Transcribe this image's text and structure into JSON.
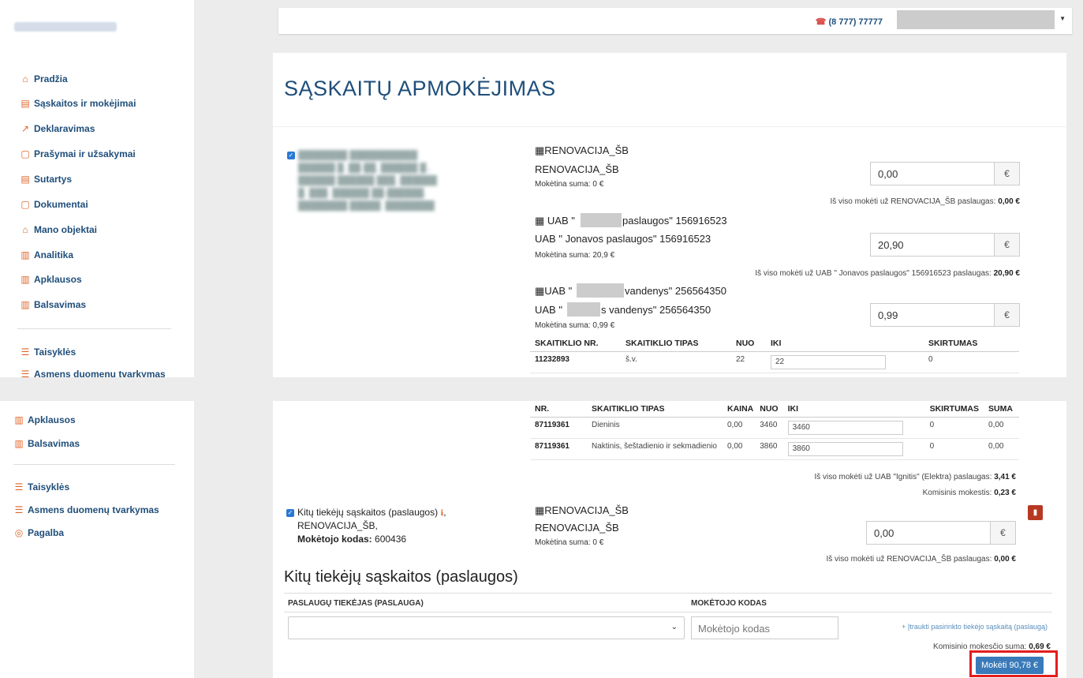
{
  "header": {
    "phone": "(8 777) 77777"
  },
  "sidebar": {
    "items": [
      {
        "icon": "home-icon",
        "glyph": "⌂",
        "label": "Pradžia"
      },
      {
        "icon": "invoice-icon",
        "glyph": "▤",
        "label": "Sąskaitos ir mokėjimai"
      },
      {
        "icon": "declaration-icon",
        "glyph": "↗",
        "label": "Deklaravimas"
      },
      {
        "icon": "request-icon",
        "glyph": "▢",
        "label": "Prašymai ir užsakymai"
      },
      {
        "icon": "contract-icon",
        "glyph": "▤",
        "label": "Sutartys"
      },
      {
        "icon": "document-icon",
        "glyph": "▢",
        "label": "Dokumentai"
      },
      {
        "icon": "property-icon",
        "glyph": "⌂",
        "label": "Mano objektai"
      },
      {
        "icon": "analytics-icon",
        "glyph": "▥",
        "label": "Analitika"
      },
      {
        "icon": "survey-icon",
        "glyph": "▥",
        "label": "Apklausos"
      },
      {
        "icon": "vote-icon",
        "glyph": "▥",
        "label": "Balsavimas"
      },
      {
        "icon": "rules-icon",
        "glyph": "☰",
        "label": "Taisyklės"
      },
      {
        "icon": "privacy-icon",
        "glyph": "☰",
        "label": "Asmens duomenų tvarkymas"
      },
      {
        "icon": "help-icon",
        "glyph": "◎",
        "label": "Pagalba"
      }
    ]
  },
  "page": {
    "title": "SĄSKAITŲ APMOKĖJIMAS"
  },
  "services": [
    {
      "header": "RENOVACIJA_ŠB",
      "name": "RENOVACIJA_ŠB",
      "due": "Mokėtina suma: 0 €",
      "amount": "0,00",
      "currency": "€",
      "total_label": "Iš viso mokėti už RENOVACIJA_ŠB paslaugas:",
      "total_value": "0,00 €"
    },
    {
      "header_a": "UAB \"",
      "header_b": "paslaugos\" 156916523",
      "name": "UAB \" Jonavos paslaugos\" 156916523",
      "due": "Mokėtina suma: 20,9 €",
      "amount": "20,90",
      "currency": "€",
      "total_label": "Iš viso mokėti už UAB \" Jonavos paslaugos\" 156916523 paslaugas:",
      "total_value": "20,90 €"
    },
    {
      "header_a": "UAB \"",
      "header_b": "vandenys\" 256564350",
      "name_a": "UAB \"",
      "name_b": "s vandenys\" 256564350",
      "due": "Mokėtina suma: 0,99 €",
      "amount": "0,99",
      "currency": "€"
    }
  ],
  "water_table": {
    "headers": [
      "SKAITIKLIO NR.",
      "SKAITIKLIO TIPAS",
      "NUO",
      "IKI",
      "SKIRTUMAS"
    ],
    "row": {
      "nr": "11232893",
      "type": "š.v.",
      "from": "22",
      "to": "22",
      "diff": "0"
    }
  },
  "elec_table": {
    "headers": [
      "NR.",
      "SKAITIKLIO TIPAS",
      "KAINA",
      "NUO",
      "IKI",
      "SKIRTUMAS",
      "SUMA"
    ],
    "rows": [
      {
        "nr": "87119361",
        "type": "Dieninis",
        "price": "0,00",
        "from": "3460",
        "to": "3460",
        "diff": "0",
        "sum": "0,00"
      },
      {
        "nr": "87119361",
        "type": "Naktinis, šeštadienio ir sekmadienio",
        "price": "0,00",
        "from": "3860",
        "to": "3860",
        "diff": "0",
        "sum": "0,00"
      }
    ],
    "total_label": "Iš viso mokėti už UAB \"Ignitis\" (Elektra) paslaugas:",
    "total_value": "3,41 €",
    "fee_label": "Komisinis mokestis:",
    "fee_value": "0,23 €"
  },
  "other_suppliers": {
    "label": "Kitų tiekėjų sąskaitos (paslaugos)",
    "info_icon": "ℹ",
    "comma": ",",
    "line2": "RENOVACIJA_ŠB,",
    "code_label": "Mokėtojo kodas:",
    "code_value": "600436",
    "service": {
      "header": "RENOVACIJA_ŠB",
      "name": "RENOVACIJA_ŠB",
      "due": "Mokėtina suma: 0 €",
      "amount": "0,00",
      "currency": "€",
      "total_label": "Iš viso mokėti už RENOVACIJA_ŠB paslaugas:",
      "total_value": "0,00 €"
    }
  },
  "add_section": {
    "title": "Kitų tiekėjų sąskaitos (paslaugos)",
    "col_supplier": "PASLAUGŲ TIEKĖJAS (PASLAUGA)",
    "col_code": "MOKĖTOJO KODAS",
    "code_placeholder": "Mokėtojo kodas",
    "add_link": "+ Įtraukti pasirinkto tiekėjo sąskaitą (paslaugą)",
    "fee_label": "Komisinio mokesčio suma:",
    "fee_value": "0,69 €",
    "pay_button": "Mokėti 90,78 €"
  },
  "colors": {
    "accent": "#1f4e7a",
    "icon": "#e0662a",
    "button": "#3a7ab8",
    "highlight": "#e41d1d",
    "trash": "#b73822"
  }
}
